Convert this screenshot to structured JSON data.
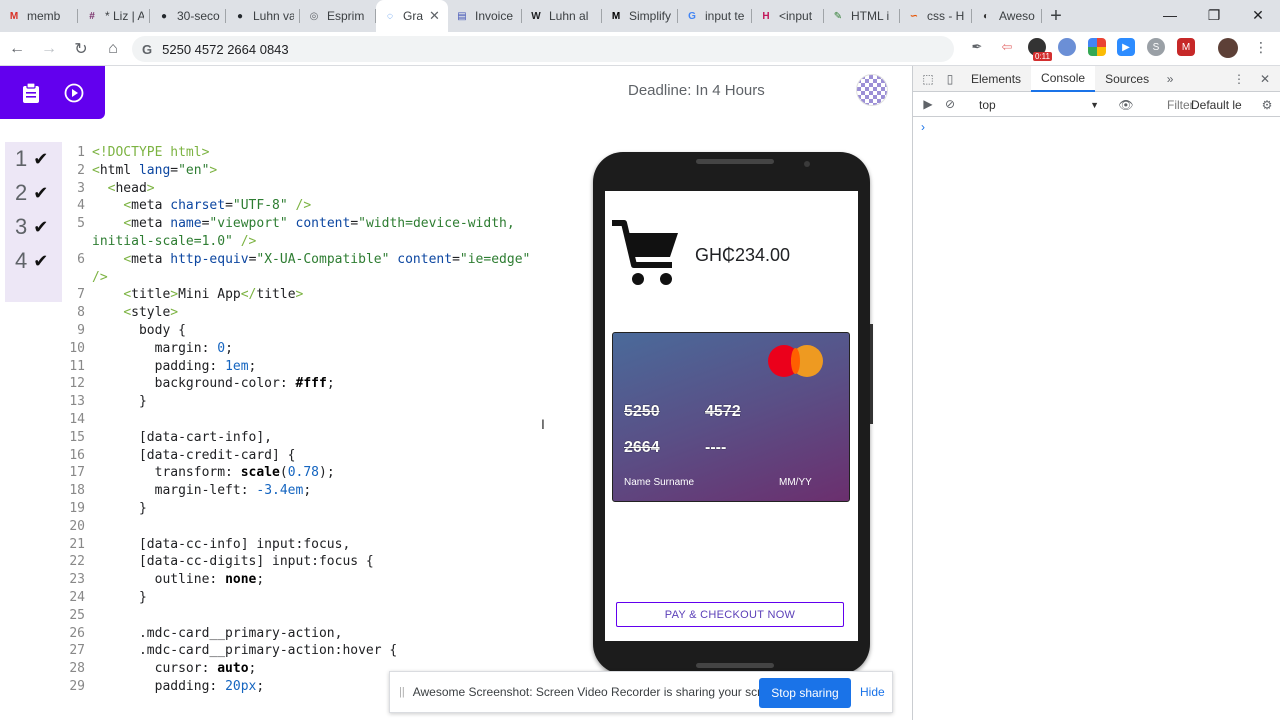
{
  "browser": {
    "tabs": [
      {
        "title": "memb",
        "icon": "gmail-icon",
        "color": "#d93025",
        "glyph": "M"
      },
      {
        "title": "* Liz | A",
        "icon": "ide-icon",
        "color": "#7a2f6b",
        "glyph": "#"
      },
      {
        "title": "30-seco",
        "icon": "github-icon",
        "color": "#24292e",
        "glyph": "●"
      },
      {
        "title": "Luhn va",
        "icon": "github-icon",
        "color": "#24292e",
        "glyph": "●"
      },
      {
        "title": "Esprim",
        "icon": "globe-icon",
        "color": "#5f6368",
        "glyph": "◎"
      },
      {
        "title": "Gra",
        "icon": "loading-icon",
        "color": "#1a73e8",
        "glyph": "◌",
        "active": true
      },
      {
        "title": "Invoice",
        "icon": "invoice-icon",
        "color": "#3f51b5",
        "glyph": "▤"
      },
      {
        "title": "Luhn al",
        "icon": "wikipedia-icon",
        "color": "#202124",
        "glyph": "W"
      },
      {
        "title": "Simplify",
        "icon": "medium-icon",
        "color": "#000000",
        "glyph": "M"
      },
      {
        "title": "input te",
        "icon": "google-icon",
        "color": "#4285f4",
        "glyph": "G"
      },
      {
        "title": "<input",
        "icon": "hacker-icon",
        "color": "#c2185b",
        "glyph": "H"
      },
      {
        "title": "HTML i",
        "icon": "code-icon",
        "color": "#2e7d32",
        "glyph": "✎"
      },
      {
        "title": "css - H",
        "icon": "css-icon",
        "color": "#e65100",
        "glyph": "∽"
      },
      {
        "title": "Aweso",
        "icon": "screenshot-icon",
        "color": "#333333",
        "glyph": "◐"
      }
    ],
    "new_tab": "+",
    "url": "5250 4572 2664 0843",
    "url_prefix": "G",
    "ext_badge": "0:11"
  },
  "app": {
    "deadline": "Deadline: In 4 Hours",
    "checks": [
      {
        "num": "1",
        "mark": "✔"
      },
      {
        "num": "2",
        "mark": "✔"
      },
      {
        "num": "3",
        "mark": "✔"
      },
      {
        "num": "4",
        "mark": "✔"
      }
    ],
    "code_lines": [
      "1",
      "2",
      "3",
      "4",
      "5",
      "",
      "6",
      "",
      "7",
      "8",
      "9",
      "10",
      "11",
      "12",
      "13",
      "14",
      "15",
      "16",
      "17",
      "18",
      "19",
      "20",
      "21",
      "22",
      "23",
      "24",
      "25",
      "26",
      "27",
      "28",
      "29"
    ]
  },
  "phone": {
    "amount": "GH₵234.00",
    "card_digits": [
      "5250",
      "4572",
      "2664",
      "----"
    ],
    "card_name": "Name Surname",
    "card_expiry": "MM/YY",
    "pay_button": "PAY & CHECKOUT NOW"
  },
  "share_bar": {
    "grip": "||",
    "message": "Awesome Screenshot: Screen Video Recorder is sharing your screen.",
    "stop": "Stop sharing",
    "hide": "Hide"
  },
  "devtools": {
    "tabs": [
      "Elements",
      "Console",
      "Sources"
    ],
    "more": "»",
    "context": "top",
    "filter": "Filter",
    "levels": "Default le",
    "prompt": "›"
  }
}
